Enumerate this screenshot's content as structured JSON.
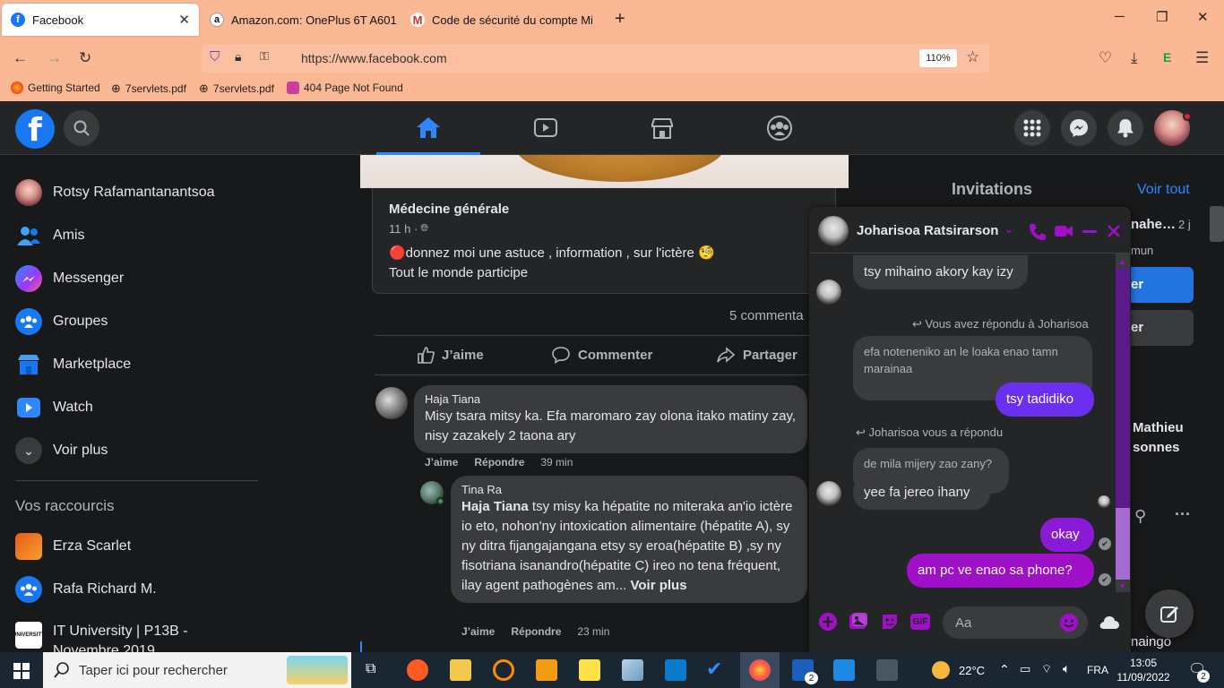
{
  "browser": {
    "tabs": [
      {
        "title": "Facebook",
        "active": true
      },
      {
        "title": "Amazon.com: OnePlus 6T A601"
      },
      {
        "title": "Code de sécurité du compte Mi"
      }
    ],
    "new_tab": "+",
    "url": "https://www.facebook.com",
    "zoom": "110%",
    "bookmarks": [
      "Getting Started",
      "7servlets.pdf",
      "7servlets.pdf",
      "404 Page Not Found"
    ],
    "colors": {
      "chrome": "#fbb895"
    }
  },
  "facebook": {
    "logo": "f",
    "sidebar": {
      "items": [
        {
          "label": "Rotsy Rafamantanantsoa",
          "icon": "profile-avatar"
        },
        {
          "label": "Amis",
          "icon": "friends-icon"
        },
        {
          "label": "Messenger",
          "icon": "messenger-icon"
        },
        {
          "label": "Groupes",
          "icon": "groups-icon"
        },
        {
          "label": "Marketplace",
          "icon": "marketplace-icon"
        },
        {
          "label": "Watch",
          "icon": "watch-icon"
        },
        {
          "label": "Voir plus",
          "icon": "chevron-down-icon"
        }
      ],
      "shortcuts_title": "Vos raccourcis",
      "shortcuts": [
        "Erza Scarlet",
        "Rafa Richard M.",
        "IT University | P13B - Novembre 2019"
      ]
    },
    "post": {
      "group": "Médecine générale",
      "time": "11 h ·",
      "text1": "🔴donnez moi une astuce , information , sur l'ictère 🧐",
      "text2": "Tout le monde participe",
      "comments_count": "5 commenta",
      "actions": {
        "like": "J’aime",
        "comment": "Commenter",
        "share": "Partager"
      }
    },
    "comments": [
      {
        "author": "Haja Tiana",
        "text": "Misy tsara mitsy ka. Efa maromaro zay olona itako matiny zay, nisy zazakely 2 taona ary",
        "like": "J’aime",
        "reply": "Répondre",
        "time": "39 min"
      },
      {
        "author": "Tina Ra",
        "mention": "Haja Tiana",
        "text": " tsy misy ka hépatite no miteraka an'io ictère io eto, nohon'ny intoxication alimentaire (hépatite A), sy ny ditra fijangajangana etsy sy eroa(hépatite B) ,sy ny fisotriana isanandro(hépatite C) ireo no tena fréquent, ilay agent pathogènes am...",
        "see_more": "Voir plus",
        "like": "J’aime",
        "reply": "Répondre",
        "time": "23 min"
      }
    ],
    "right": {
      "invitations": "Invitations",
      "see_all": "Voir tout",
      "peek1": "nahe…",
      "peek1_time": "2 j",
      "peek2": "mun",
      "peek3": "er",
      "peek4": "er",
      "peek_name1": "Mathieu",
      "peek_name2": "sonnes",
      "peek_bottom": "naingo"
    },
    "chat": {
      "contact": "Joharisoa Ratsirarson",
      "messages": [
        {
          "dir": "in",
          "text": "tsy mihaino akory kay izy"
        },
        {
          "dir": "meta",
          "text": "Vous avez répondu à Joharisoa"
        },
        {
          "dir": "quote",
          "text": "efa noteneniko an le loaka enao tamn marainaa"
        },
        {
          "dir": "out",
          "text": "tsy tadidiko"
        },
        {
          "dir": "meta",
          "text": "Joharisoa vous a répondu"
        },
        {
          "dir": "quote",
          "text": "de mila mijery zao zany?"
        },
        {
          "dir": "in",
          "text": "yee fa jereo ihany"
        },
        {
          "dir": "out",
          "text": "okay"
        },
        {
          "dir": "out",
          "text": "am pc ve enao sa phone?"
        }
      ],
      "input_placeholder": "Aa",
      "accent": "#a010c8"
    }
  },
  "taskbar": {
    "search_placeholder": "Taper ici pour rechercher",
    "temp": "22°C",
    "lang": "FRA",
    "time": "13:05",
    "date": "11/09/2022",
    "notif_count": "2",
    "app_badge": "2"
  }
}
